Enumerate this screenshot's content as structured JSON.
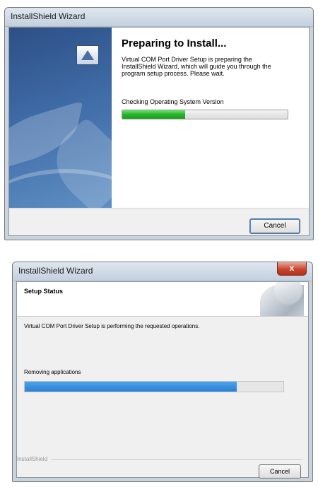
{
  "window1": {
    "title": "InstallShield Wizard",
    "heading": "Preparing to Install...",
    "description": "Virtual COM Port Driver Setup is preparing the InstallShield Wizard, which will guide you through the program setup process.  Please wait.",
    "status": "Checking Operating System Version",
    "progress_fraction": 0.38,
    "progress_color": "#29b32b",
    "cancel_label": "Cancel"
  },
  "window2": {
    "title": "InstallShield Wizard",
    "close_label": "x",
    "heading": "Setup Status",
    "description": "Virtual COM Port Driver Setup is performing the requested operations.",
    "status": "Removing applications",
    "progress_fraction": 0.82,
    "progress_color": "#2b7fd0",
    "brand": "InstallShield",
    "cancel_label": "Cancel"
  }
}
